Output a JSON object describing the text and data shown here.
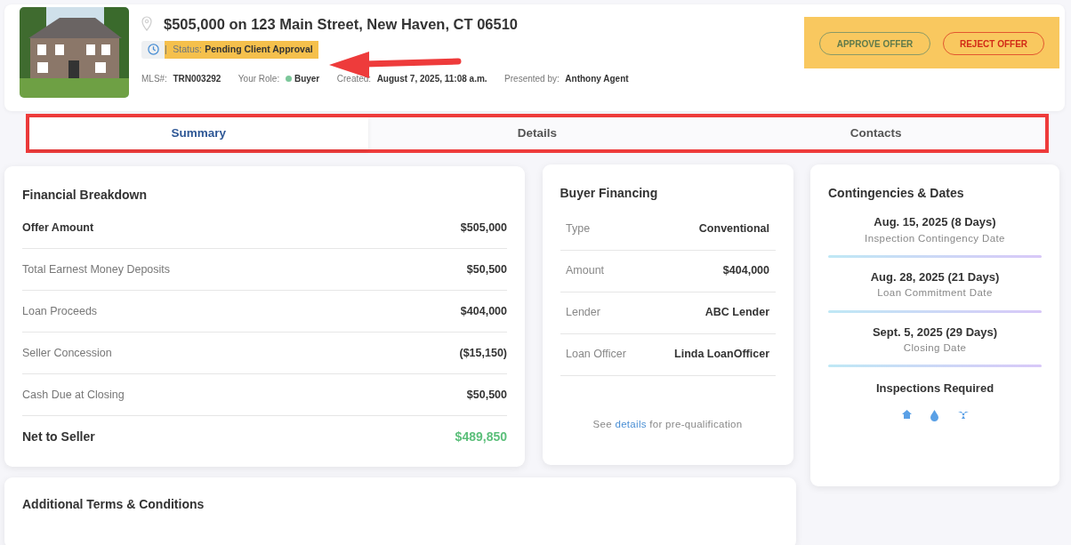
{
  "header": {
    "title": "$505,000 on 123 Main Street, New Haven, CT 06510",
    "status": {
      "label": "Status:",
      "value": "Pending Client Approval",
      "separator": "|",
      "highlighted": true
    },
    "meta": [
      {
        "label": "MLS#:",
        "value": "TRN003292"
      },
      {
        "label": "Your Role:",
        "value": "Buyer",
        "color": "#7cc79a"
      },
      {
        "label": "Created:",
        "value": "August 7, 2025, 11:08 a.m."
      },
      {
        "label": "Presented by:",
        "value": "Anthony Agent"
      }
    ],
    "actions": {
      "highlighted": true,
      "buttons": [
        {
          "label": "APPROVE OFFER",
          "kind": "approve"
        },
        {
          "label": "REJECT OFFER",
          "kind": "reject"
        }
      ]
    }
  },
  "tabs": [
    {
      "label": "Summary",
      "selected": true
    },
    {
      "label": "Details",
      "selected": false
    },
    {
      "label": "Contacts",
      "selected": false
    }
  ],
  "financial": {
    "title": "Financial Breakdown",
    "rows": [
      {
        "label": "Offer Amount",
        "value": "$505,000",
        "kind": "strong"
      },
      {
        "label": "Total Earnest Money Deposits",
        "value": "$50,500",
        "kind": "plain"
      },
      {
        "label": "Loan Proceeds",
        "value": "$404,000",
        "kind": "plain"
      },
      {
        "label": "Seller Concession",
        "value": "($15,150)",
        "kind": "plain"
      },
      {
        "label": "Cash Due at Closing",
        "value": "$50,500",
        "kind": "plain"
      },
      {
        "label": "Net to Seller",
        "value": "$489,850",
        "kind": "total"
      }
    ]
  },
  "financing": {
    "title": "Buyer Financing",
    "rows": [
      {
        "label": "Type",
        "value": "Conventional"
      },
      {
        "label": "Amount",
        "value": "$404,000"
      },
      {
        "label": "Lender",
        "value": "ABC Lender"
      },
      {
        "label": "Loan Officer",
        "value": "Linda LoanOfficer"
      }
    ],
    "note": {
      "before": "See",
      "link": "details",
      "after": "for pre-qualification"
    }
  },
  "contingencies": {
    "title": "Contingencies & Dates",
    "dates": [
      {
        "date": "Aug. 15, 2025 (8 Days)",
        "label": "Inspection Contingency Date"
      },
      {
        "date": "Aug. 28, 2025 (21 Days)",
        "label": "Loan Commitment Date"
      },
      {
        "date": "Sept. 5, 2025 (29 Days)",
        "label": "Closing Date"
      }
    ],
    "inspections_title": "Inspections Required",
    "inspections": [
      {
        "kind": "home"
      },
      {
        "kind": "water"
      },
      {
        "kind": "radon"
      }
    ]
  },
  "terms": {
    "title": "Additional Terms & Conditions"
  }
}
